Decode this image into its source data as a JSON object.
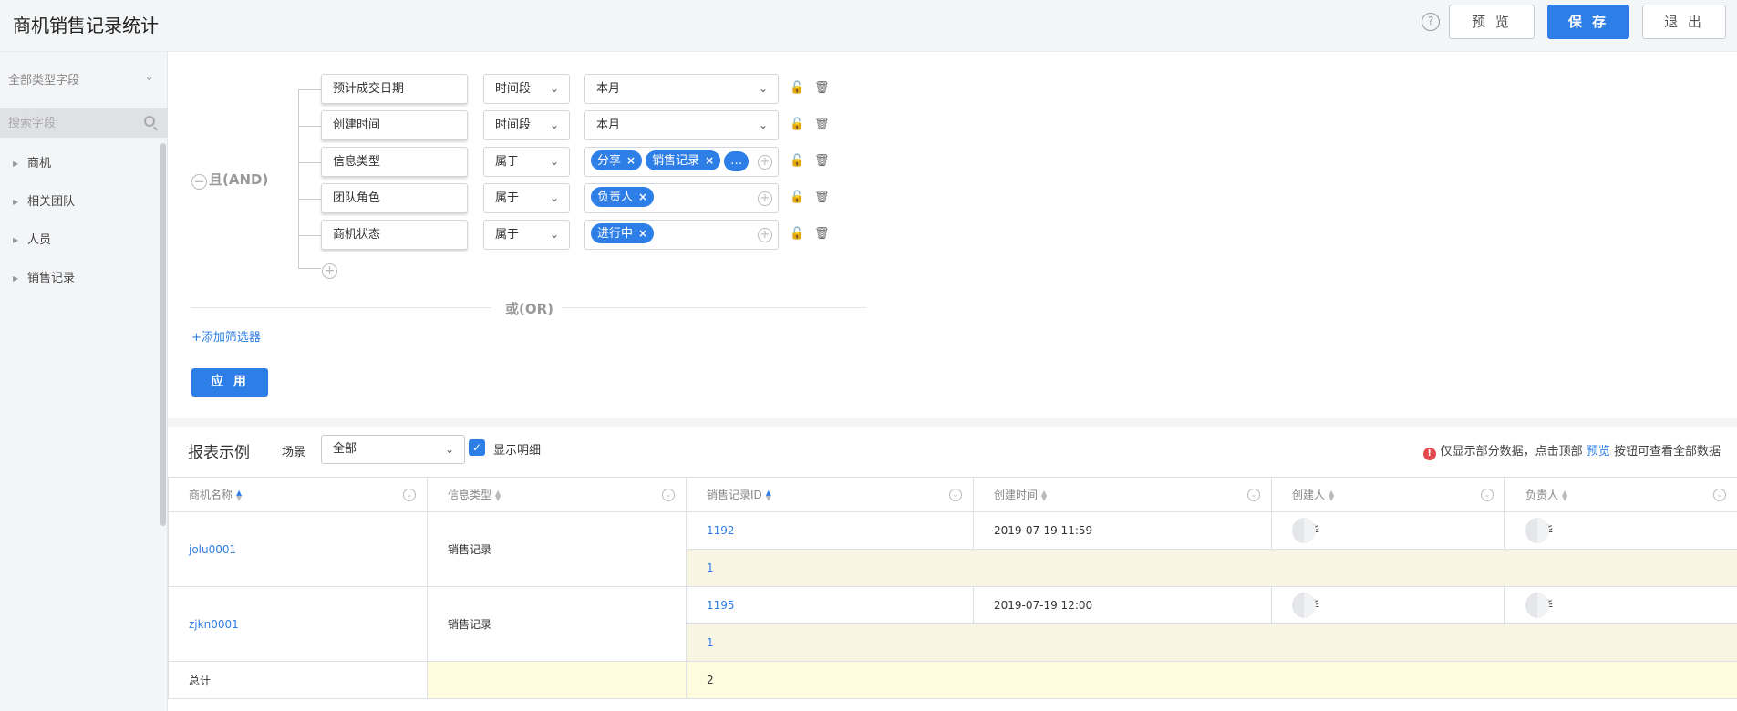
{
  "header": {
    "title": "商机销售记录统计",
    "help_icon": "?",
    "preview_label": "预 览",
    "save_label": "保 存",
    "exit_label": "退 出"
  },
  "sidebar": {
    "type_filter": "全部类型字段",
    "search_placeholder": "搜索字段",
    "items": [
      {
        "label": "商机"
      },
      {
        "label": "相关团队"
      },
      {
        "label": "人员"
      },
      {
        "label": "销售记录"
      }
    ]
  },
  "filters": {
    "logic_label": "且(AND)",
    "rows": [
      {
        "field": "预计成交日期",
        "operator": "时间段",
        "value": "本月",
        "tags": []
      },
      {
        "field": "创建时间",
        "operator": "时间段",
        "value": "本月",
        "tags": []
      },
      {
        "field": "信息类型",
        "operator": "属于",
        "value": "",
        "tags": [
          "分享",
          "销售记录",
          "…"
        ]
      },
      {
        "field": "团队角色",
        "operator": "属于",
        "value": "",
        "tags": [
          "负责人"
        ]
      },
      {
        "field": "商机状态",
        "operator": "属于",
        "value": "",
        "tags": [
          "进行中"
        ]
      }
    ],
    "or_label": "或(OR)",
    "add_filter_label": "+添加筛选器",
    "apply_label": "应 用"
  },
  "report": {
    "title": "报表示例",
    "scene_label": "场景",
    "scene_value": "全部",
    "show_detail_label": "显示明细",
    "notice_prefix": "仅显示部分数据，点击顶部",
    "notice_link": "预览",
    "notice_suffix": "按钮可查看全部数据",
    "columns": [
      "商机名称",
      "信息类型",
      "销售记录ID",
      "创建时间",
      "创建人",
      "负责人"
    ],
    "groups": [
      {
        "name": "jolu0001",
        "type": "销售记录",
        "record_id": "1192",
        "created": "2019-07-19 11:59",
        "creator": "华",
        "owner": "华",
        "subtotal": "1"
      },
      {
        "name": "zjkn0001",
        "type": "销售记录",
        "record_id": "1195",
        "created": "2019-07-19 12:00",
        "creator": "华",
        "owner": "华",
        "subtotal": "1"
      }
    ],
    "total_label": "总计",
    "total_value": "2"
  },
  "colors": {
    "accent": "#2d7ee6",
    "subtotal_bg": "#f8f5e4",
    "total_bg": "#fefbdf",
    "warn": "#e5484d"
  }
}
